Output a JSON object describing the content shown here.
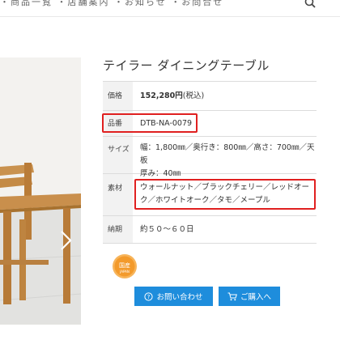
{
  "topnav": {
    "text": "・商品一覧 ・店舗案内 ・お知らせ ・お問合せ"
  },
  "product": {
    "title": "テイラー ダイニングテーブル",
    "specs": {
      "price_label": "価格",
      "price_value": "152,280円",
      "price_tax": "(税込)",
      "code_label": "品番",
      "code_value": "DTB-NA-0079",
      "size_label": "サイズ",
      "size_line1": "幅：1,800㎜／奥行き：800㎜／高さ：700㎜／天板",
      "size_line2": "厚み：40㎜",
      "material_label": "素材",
      "material_line1": "ウォールナット／ブラックチェリー／レッドオー",
      "material_line2": "ク／ホワイトオーク／タモ／メープル",
      "delivery_label": "納期",
      "delivery_value": "約５０～６０日"
    }
  },
  "badge": {
    "top": "国産",
    "bottom": "JAPAN"
  },
  "buttons": {
    "inquiry": "お問い合わせ",
    "purchase": "ご購入へ"
  },
  "colors": {
    "accent_blue": "#1e8ddc",
    "highlight_red": "#e02020",
    "badge_orange": "#f39a2b"
  },
  "icons": {
    "search": "search-icon",
    "next": "chevron-right-icon",
    "help": "question-circle-icon",
    "cart": "cart-icon"
  }
}
